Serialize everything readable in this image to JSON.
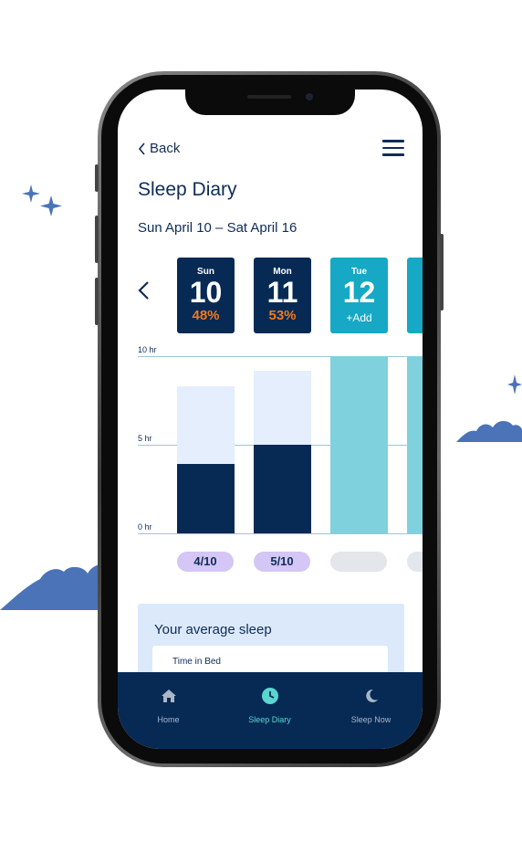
{
  "header": {
    "back_label": "Back",
    "title": "Sleep Diary",
    "date_range": "Sun April 10 – Sat April 16"
  },
  "days": [
    {
      "name": "Sun",
      "number": "10",
      "value": "48%",
      "state": "logged"
    },
    {
      "name": "Mon",
      "number": "11",
      "value": "53%",
      "state": "logged"
    },
    {
      "name": "Tue",
      "number": "12",
      "value": "+Add",
      "state": "add"
    }
  ],
  "chart": {
    "y_labels": [
      "10 hr",
      "5 hr",
      "0 hr"
    ],
    "bars": [
      {
        "time_in_bed_hr": 8.3,
        "asleep_hr": 3.9
      },
      {
        "time_in_bed_hr": 9.2,
        "asleep_hr": 5.0
      },
      {
        "time_in_bed_hr": 10,
        "asleep_hr": null
      },
      {
        "time_in_bed_hr": 10,
        "asleep_hr": null
      }
    ],
    "pills": [
      "4/10",
      "5/10",
      "",
      ""
    ]
  },
  "average": {
    "title": "Your average sleep",
    "row_label": "Time in Bed"
  },
  "tabs": [
    {
      "label": "Home",
      "icon": "home-icon"
    },
    {
      "label": "Sleep Diary",
      "icon": "clock-icon",
      "active": true
    },
    {
      "label": "Sleep Now",
      "icon": "moon-icon"
    }
  ],
  "colors": {
    "navy": "#0f2c57",
    "card_dark": "#072a55",
    "card_teal": "#16a8c4",
    "bar_light": "#e4eefc",
    "bar_dark": "#072a55",
    "bar_teal": "#7fd1de",
    "accent_orange": "#f07a1c",
    "pill_purple": "#d4c6f5",
    "pill_grey": "#e3e6ea",
    "tab_active": "#5ad6cf",
    "decor_blue": "#4a73b8"
  }
}
